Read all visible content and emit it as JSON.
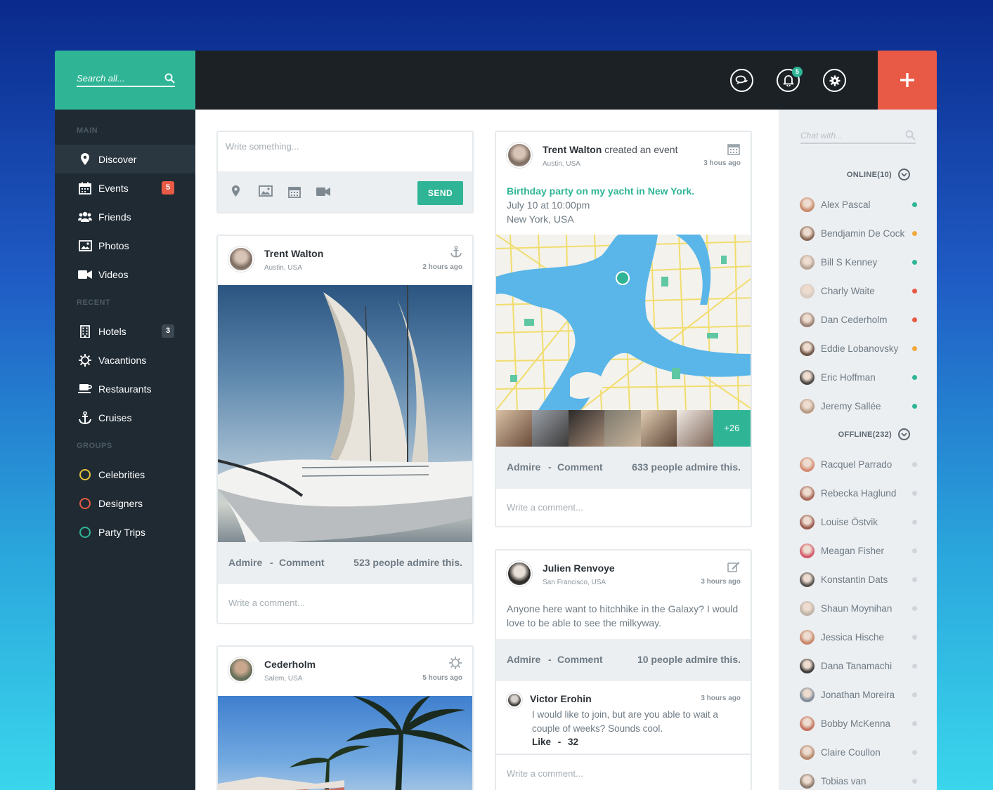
{
  "search": {
    "placeholder": "Search all..."
  },
  "topbar": {
    "notification_count": "5"
  },
  "sidebar": {
    "sections": {
      "main": "MAIN",
      "recent": "RECENT",
      "groups": "GROUPS"
    },
    "main_items": [
      {
        "label": "Discover",
        "icon": "map-pin-icon"
      },
      {
        "label": "Events",
        "icon": "calendar-icon",
        "badge": "5",
        "badge_color": "#e85a45"
      },
      {
        "label": "Friends",
        "icon": "users-icon"
      },
      {
        "label": "Photos",
        "icon": "image-icon"
      },
      {
        "label": "Videos",
        "icon": "video-icon"
      }
    ],
    "recent_items": [
      {
        "label": "Hotels",
        "icon": "building-icon",
        "badge": "3",
        "badge_color": "#3c4952"
      },
      {
        "label": "Vacantions",
        "icon": "sun-icon"
      },
      {
        "label": "Restaurants",
        "icon": "coffee-cup-icon"
      },
      {
        "label": "Cruises",
        "icon": "anchor-icon"
      }
    ],
    "group_items": [
      {
        "label": "Celebrities",
        "color": "#e8c43c"
      },
      {
        "label": "Designers",
        "color": "#e85a45"
      },
      {
        "label": "Party Trips",
        "color": "#2fb596"
      }
    ]
  },
  "compose": {
    "placeholder": "Write something...",
    "send_label": "SEND"
  },
  "post1": {
    "name": "Trent Walton",
    "location": "Austin, USA",
    "time": "2 hours ago",
    "admire": "Admire",
    "sep": "-",
    "comment": "Comment",
    "admire_count": "523 people admire this.",
    "comment_placeholder": "Write a comment..."
  },
  "post2": {
    "name": "Cederholm",
    "location": "Salem, USA",
    "time": "5 hours ago"
  },
  "event": {
    "name": "Trent Walton",
    "action": "created an event",
    "location": "Austin, USA",
    "time": "3 hous ago",
    "title": "Birthday party on my yacht in New York.",
    "date": "July 10 at 10:00pm",
    "place": "New York, USA",
    "more_attendees": "+26",
    "admire": "Admire",
    "sep": "-",
    "comment": "Comment",
    "admire_count": "633 people admire this.",
    "comment_placeholder": "Write a comment..."
  },
  "status_post": {
    "name": "Julien Renvoye",
    "location": "San Francisco, USA",
    "time": "3 hours ago",
    "text": "Anyone here want to hitchhike in the Galaxy? I would love to be able to see the milkyway.",
    "admire": "Admire",
    "sep": "-",
    "comment": "Comment",
    "admire_count": "10 people admire this.",
    "reply": {
      "name": "Victor Erohin",
      "time": "3 hours ago",
      "text": "I would like to join, but are you able to wait a couple of weeks? Sounds cool.",
      "like": "Like",
      "sep": "-",
      "likes": "32"
    },
    "comment_placeholder": "Write a comment..."
  },
  "chat": {
    "placeholder": "Chat with...",
    "online_label": "ONLINE(10)",
    "offline_label": "OFFLINE(232)",
    "online": [
      {
        "name": "Alex Pascal",
        "status": "#2fb596"
      },
      {
        "name": "Bendjamin De Cock",
        "status": "#f0a93a"
      },
      {
        "name": "Bill S Kenney",
        "status": "#2fb596"
      },
      {
        "name": "Charly Waite",
        "status": "#e85a45"
      },
      {
        "name": "Dan Cederholm",
        "status": "#e85a45"
      },
      {
        "name": "Eddie Lobanovsky",
        "status": "#f0a93a"
      },
      {
        "name": "Eric Hoffman",
        "status": "#2fb596"
      },
      {
        "name": "Jeremy Sallée",
        "status": "#2fb596"
      }
    ],
    "offline": [
      {
        "name": "Racquel Parrado"
      },
      {
        "name": "Rebecka Haglund"
      },
      {
        "name": "Louise Östvik"
      },
      {
        "name": "Meagan Fisher"
      },
      {
        "name": "Konstantin Dats"
      },
      {
        "name": "Shaun Moynihan"
      },
      {
        "name": "Jessica Hische"
      },
      {
        "name": "Dana Tanamachi"
      },
      {
        "name": "Jonathan Moreira"
      },
      {
        "name": "Bobby McKenna"
      },
      {
        "name": "Claire Coullon"
      },
      {
        "name": "Tobias van"
      }
    ]
  }
}
